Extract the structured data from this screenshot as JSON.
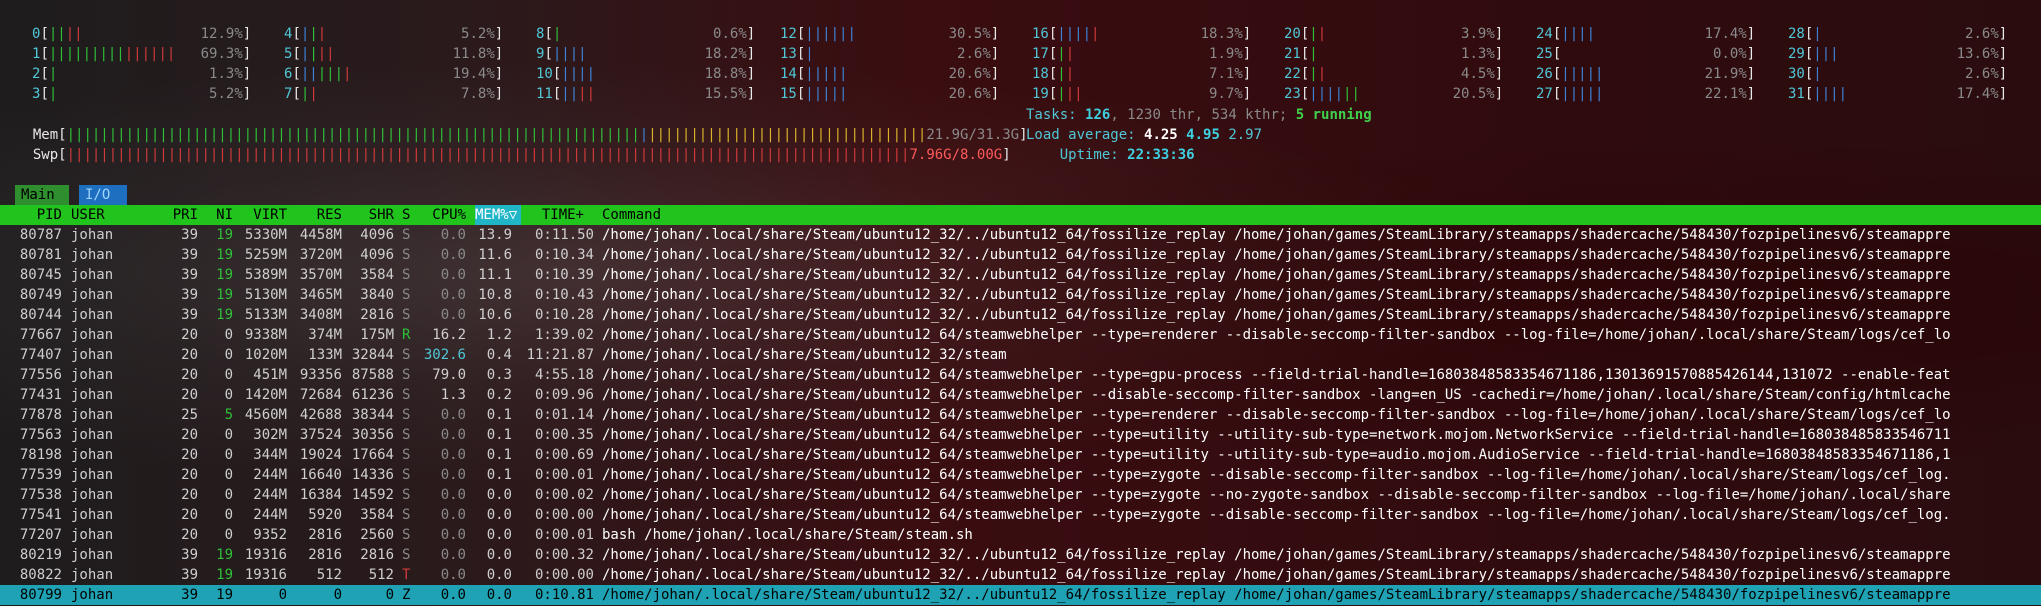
{
  "cpus": [
    {
      "id": "0",
      "bars": [
        [
          "g",
          "||"
        ],
        [
          "r",
          "||"
        ]
      ],
      "pct": "12.9%"
    },
    {
      "id": "1",
      "bars": [
        [
          "g",
          "|||||||||"
        ],
        [
          "r",
          "||||||"
        ]
      ],
      "pct": "69.3%"
    },
    {
      "id": "2",
      "bars": [
        [
          "g",
          "|"
        ]
      ],
      "pct": "1.3%"
    },
    {
      "id": "3",
      "bars": [
        [
          "g",
          "|"
        ]
      ],
      "pct": "5.2%"
    },
    {
      "id": "4",
      "bars": [
        [
          "b",
          "|"
        ],
        [
          "g",
          "|"
        ],
        [
          "r",
          "|"
        ]
      ],
      "pct": "5.2%"
    },
    {
      "id": "5",
      "bars": [
        [
          "b",
          "|"
        ],
        [
          "g",
          "|"
        ],
        [
          "r",
          "||"
        ]
      ],
      "pct": "11.8%"
    },
    {
      "id": "6",
      "bars": [
        [
          "b",
          "||"
        ],
        [
          "g",
          "|||"
        ],
        [
          "r",
          "|"
        ]
      ],
      "pct": "19.4%"
    },
    {
      "id": "7",
      "bars": [
        [
          "g",
          "|"
        ],
        [
          "r",
          "|"
        ]
      ],
      "pct": "7.8%"
    },
    {
      "id": "8",
      "bars": [
        [
          "g",
          "|"
        ]
      ],
      "pct": "0.6%"
    },
    {
      "id": "9",
      "bars": [
        [
          "b",
          "||||"
        ]
      ],
      "pct": "18.2%"
    },
    {
      "id": "10",
      "bars": [
        [
          "b",
          "||||"
        ]
      ],
      "pct": "18.8%"
    },
    {
      "id": "11",
      "bars": [
        [
          "b",
          "||"
        ],
        [
          "r",
          "||"
        ]
      ],
      "pct": "15.5%"
    },
    {
      "id": "12",
      "bars": [
        [
          "b",
          "||||||"
        ]
      ],
      "pct": "30.5%"
    },
    {
      "id": "13",
      "bars": [
        [
          "b",
          "|"
        ]
      ],
      "pct": "2.6%"
    },
    {
      "id": "14",
      "bars": [
        [
          "b",
          "|||||"
        ]
      ],
      "pct": "20.6%"
    },
    {
      "id": "15",
      "bars": [
        [
          "b",
          "|||||"
        ]
      ],
      "pct": "20.6%"
    },
    {
      "id": "16",
      "bars": [
        [
          "b",
          "||||"
        ],
        [
          "r",
          "|"
        ]
      ],
      "pct": "18.3%"
    },
    {
      "id": "17",
      "bars": [
        [
          "g",
          "|"
        ],
        [
          "r",
          "|"
        ]
      ],
      "pct": "1.9%"
    },
    {
      "id": "18",
      "bars": [
        [
          "g",
          "|"
        ],
        [
          "r",
          "|"
        ]
      ],
      "pct": "7.1%"
    },
    {
      "id": "19",
      "bars": [
        [
          "g",
          "|"
        ],
        [
          "r",
          "||"
        ]
      ],
      "pct": "9.7%"
    },
    {
      "id": "20",
      "bars": [
        [
          "g",
          "|"
        ],
        [
          "r",
          "|"
        ]
      ],
      "pct": "3.9%"
    },
    {
      "id": "21",
      "bars": [
        [
          "g",
          "|"
        ]
      ],
      "pct": "1.3%"
    },
    {
      "id": "22",
      "bars": [
        [
          "g",
          "|"
        ],
        [
          "r",
          "|"
        ]
      ],
      "pct": "4.5%"
    },
    {
      "id": "23",
      "bars": [
        [
          "b",
          "||||"
        ],
        [
          "g",
          "||"
        ]
      ],
      "pct": "20.5%"
    },
    {
      "id": "24",
      "bars": [
        [
          "b",
          "||||"
        ]
      ],
      "pct": "17.4%"
    },
    {
      "id": "25",
      "bars": [],
      "pct": "0.0%"
    },
    {
      "id": "26",
      "bars": [
        [
          "b",
          "|||||"
        ]
      ],
      "pct": "21.9%"
    },
    {
      "id": "27",
      "bars": [
        [
          "b",
          "|||||"
        ]
      ],
      "pct": "22.1%"
    },
    {
      "id": "28",
      "bars": [
        [
          "b",
          "|"
        ]
      ],
      "pct": "2.6%"
    },
    {
      "id": "29",
      "bars": [
        [
          "b",
          "|||"
        ]
      ],
      "pct": "13.6%"
    },
    {
      "id": "30",
      "bars": [
        [
          "b",
          "|"
        ]
      ],
      "pct": "2.6%"
    },
    {
      "id": "31",
      "bars": [
        [
          "b",
          "||||"
        ]
      ],
      "pct": "17.4%"
    }
  ],
  "mem": {
    "label": "Mem",
    "value": "21.9G/31.3G",
    "used_fraction": 0.7
  },
  "swp": {
    "label": "Swp",
    "value": "7.96G/8.00G",
    "used_fraction": 0.995
  },
  "tasks": {
    "label": "Tasks:",
    "count": "126",
    "thr": "1230 thr,",
    "kthr": "534 kthr;",
    "running": "5 running"
  },
  "load": {
    "label": "Load average:",
    "v1": "4.25",
    "v5": "4.95",
    "v15": "2.97"
  },
  "uptime": {
    "label": "Uptime:",
    "value": "22:33:36"
  },
  "tabs": {
    "main": "Main",
    "io": "I/O"
  },
  "headers": {
    "pid": "PID",
    "user": "USER",
    "pri": "PRI",
    "ni": "NI",
    "virt": "VIRT",
    "res": "RES",
    "shr": "SHR",
    "s": "S",
    "cpu": "CPU%",
    "mem": "MEM%▽",
    "time": "TIME+",
    "command": "Command"
  },
  "processes": [
    {
      "pid": "80787",
      "user": "johan",
      "pri": "39",
      "ni": "19",
      "virt": "5330M",
      "res": "4458M",
      "shr": "4096",
      "s": "S",
      "cpu": "0.0",
      "mem": "13.9",
      "time": "0:11.50",
      "cmd": "/home/johan/.local/share/Steam/ubuntu12_32/../ubuntu12_64/fossilize_replay /home/johan/games/SteamLibrary/steamapps/shadercache/548430/fozpipelinesv6/steamappre"
    },
    {
      "pid": "80781",
      "user": "johan",
      "pri": "39",
      "ni": "19",
      "virt": "5259M",
      "res": "3720M",
      "shr": "4096",
      "s": "S",
      "cpu": "0.0",
      "mem": "11.6",
      "time": "0:10.34",
      "cmd": "/home/johan/.local/share/Steam/ubuntu12_32/../ubuntu12_64/fossilize_replay /home/johan/games/SteamLibrary/steamapps/shadercache/548430/fozpipelinesv6/steamappre"
    },
    {
      "pid": "80745",
      "user": "johan",
      "pri": "39",
      "ni": "19",
      "virt": "5389M",
      "res": "3570M",
      "shr": "3584",
      "s": "S",
      "cpu": "0.0",
      "mem": "11.1",
      "time": "0:10.39",
      "cmd": "/home/johan/.local/share/Steam/ubuntu12_32/../ubuntu12_64/fossilize_replay /home/johan/games/SteamLibrary/steamapps/shadercache/548430/fozpipelinesv6/steamappre"
    },
    {
      "pid": "80749",
      "user": "johan",
      "pri": "39",
      "ni": "19",
      "virt": "5130M",
      "res": "3465M",
      "shr": "3840",
      "s": "S",
      "cpu": "0.0",
      "mem": "10.8",
      "time": "0:10.43",
      "cmd": "/home/johan/.local/share/Steam/ubuntu12_32/../ubuntu12_64/fossilize_replay /home/johan/games/SteamLibrary/steamapps/shadercache/548430/fozpipelinesv6/steamappre"
    },
    {
      "pid": "80744",
      "user": "johan",
      "pri": "39",
      "ni": "19",
      "virt": "5133M",
      "res": "3408M",
      "shr": "2816",
      "s": "S",
      "cpu": "0.0",
      "mem": "10.6",
      "time": "0:10.28",
      "cmd": "/home/johan/.local/share/Steam/ubuntu12_32/../ubuntu12_64/fossilize_replay /home/johan/games/SteamLibrary/steamapps/shadercache/548430/fozpipelinesv6/steamappre"
    },
    {
      "pid": "77667",
      "user": "johan",
      "pri": "20",
      "ni": "0",
      "virt": "9338M",
      "res": "374M",
      "shr": "175M",
      "s": "R",
      "cpu": "16.2",
      "mem": "1.2",
      "time": "1:39.02",
      "cmd": "/home/johan/.local/share/Steam/ubuntu12_64/steamwebhelper --type=renderer --disable-seccomp-filter-sandbox --log-file=/home/johan/.local/share/Steam/logs/cef_lo"
    },
    {
      "pid": "77407",
      "user": "johan",
      "pri": "20",
      "ni": "0",
      "virt": "1020M",
      "res": "133M",
      "shr": "32844",
      "s": "S",
      "cpu": "302.6",
      "mem": "0.4",
      "time": "11:21.87",
      "cmd": "/home/johan/.local/share/Steam/ubuntu12_32/steam"
    },
    {
      "pid": "77556",
      "user": "johan",
      "pri": "20",
      "ni": "0",
      "virt": "451M",
      "res": "93356",
      "shr": "87588",
      "s": "S",
      "cpu": "79.0",
      "mem": "0.3",
      "time": "4:55.18",
      "cmd": "/home/johan/.local/share/Steam/ubuntu12_64/steamwebhelper --type=gpu-process --field-trial-handle=16803848583354671186,13013691570885426144,131072 --enable-feat"
    },
    {
      "pid": "77431",
      "user": "johan",
      "pri": "20",
      "ni": "0",
      "virt": "1420M",
      "res": "72684",
      "shr": "61236",
      "s": "S",
      "cpu": "1.3",
      "mem": "0.2",
      "time": "0:09.96",
      "cmd": "/home/johan/.local/share/Steam/ubuntu12_64/steamwebhelper --disable-seccomp-filter-sandbox -lang=en_US -cachedir=/home/johan/.local/share/Steam/config/htmlcache"
    },
    {
      "pid": "77878",
      "user": "johan",
      "pri": "25",
      "ni": "5",
      "virt": "4560M",
      "res": "42688",
      "shr": "38344",
      "s": "S",
      "cpu": "0.0",
      "mem": "0.1",
      "time": "0:01.14",
      "cmd": "/home/johan/.local/share/Steam/ubuntu12_64/steamwebhelper --type=renderer --disable-seccomp-filter-sandbox --log-file=/home/johan/.local/share/Steam/logs/cef_lo"
    },
    {
      "pid": "77563",
      "user": "johan",
      "pri": "20",
      "ni": "0",
      "virt": "302M",
      "res": "37524",
      "shr": "30356",
      "s": "S",
      "cpu": "0.0",
      "mem": "0.1",
      "time": "0:00.35",
      "cmd": "/home/johan/.local/share/Steam/ubuntu12_64/steamwebhelper --type=utility --utility-sub-type=network.mojom.NetworkService --field-trial-handle=168038485833546711"
    },
    {
      "pid": "78198",
      "user": "johan",
      "pri": "20",
      "ni": "0",
      "virt": "344M",
      "res": "19024",
      "shr": "17664",
      "s": "S",
      "cpu": "0.0",
      "mem": "0.1",
      "time": "0:00.69",
      "cmd": "/home/johan/.local/share/Steam/ubuntu12_64/steamwebhelper --type=utility --utility-sub-type=audio.mojom.AudioService --field-trial-handle=16803848583354671186,1"
    },
    {
      "pid": "77539",
      "user": "johan",
      "pri": "20",
      "ni": "0",
      "virt": "244M",
      "res": "16640",
      "shr": "14336",
      "s": "S",
      "cpu": "0.0",
      "mem": "0.1",
      "time": "0:00.01",
      "cmd": "/home/johan/.local/share/Steam/ubuntu12_64/steamwebhelper --type=zygote --disable-seccomp-filter-sandbox --log-file=/home/johan/.local/share/Steam/logs/cef_log."
    },
    {
      "pid": "77538",
      "user": "johan",
      "pri": "20",
      "ni": "0",
      "virt": "244M",
      "res": "16384",
      "shr": "14592",
      "s": "S",
      "cpu": "0.0",
      "mem": "0.0",
      "time": "0:00.02",
      "cmd": "/home/johan/.local/share/Steam/ubuntu12_64/steamwebhelper --type=zygote --no-zygote-sandbox --disable-seccomp-filter-sandbox --log-file=/home/johan/.local/share"
    },
    {
      "pid": "77541",
      "user": "johan",
      "pri": "20",
      "ni": "0",
      "virt": "244M",
      "res": "5920",
      "shr": "3584",
      "s": "S",
      "cpu": "0.0",
      "mem": "0.0",
      "time": "0:00.00",
      "cmd": "/home/johan/.local/share/Steam/ubuntu12_64/steamwebhelper --type=zygote --disable-seccomp-filter-sandbox --log-file=/home/johan/.local/share/Steam/logs/cef_log."
    },
    {
      "pid": "77207",
      "user": "johan",
      "pri": "20",
      "ni": "0",
      "virt": "9352",
      "res": "2816",
      "shr": "2560",
      "s": "S",
      "cpu": "0.0",
      "mem": "0.0",
      "time": "0:00.01",
      "cmd": "bash /home/johan/.local/share/Steam/steam.sh"
    },
    {
      "pid": "80219",
      "user": "johan",
      "pri": "39",
      "ni": "19",
      "virt": "19316",
      "res": "2816",
      "shr": "2816",
      "s": "S",
      "cpu": "0.0",
      "mem": "0.0",
      "time": "0:00.32",
      "cmd": "/home/johan/.local/share/Steam/ubuntu12_32/../ubuntu12_64/fossilize_replay /home/johan/games/SteamLibrary/steamapps/shadercache/548430/fozpipelinesv6/steamappre"
    },
    {
      "pid": "80822",
      "user": "johan",
      "pri": "39",
      "ni": "19",
      "virt": "19316",
      "res": "512",
      "shr": "512",
      "s": "T",
      "cpu": "0.0",
      "mem": "0.0",
      "time": "0:00.00",
      "cmd": "/home/johan/.local/share/Steam/ubuntu12_32/../ubuntu12_64/fossilize_replay /home/johan/games/SteamLibrary/steamapps/shadercache/548430/fozpipelinesv6/steamappre"
    },
    {
      "pid": "80799",
      "user": "johan",
      "pri": "39",
      "ni": "19",
      "virt": "0",
      "res": "0",
      "shr": "0",
      "s": "Z",
      "cpu": "0.0",
      "mem": "0.0",
      "time": "0:10.81",
      "cmd": "/home/johan/.local/share/Steam/ubuntu12_32/../ubuntu12_64/fossilize_replay /home/johan/games/SteamLibrary/steamapps/shadercache/548430/fozpipelinesv6/steamappre",
      "selected": true
    }
  ]
}
